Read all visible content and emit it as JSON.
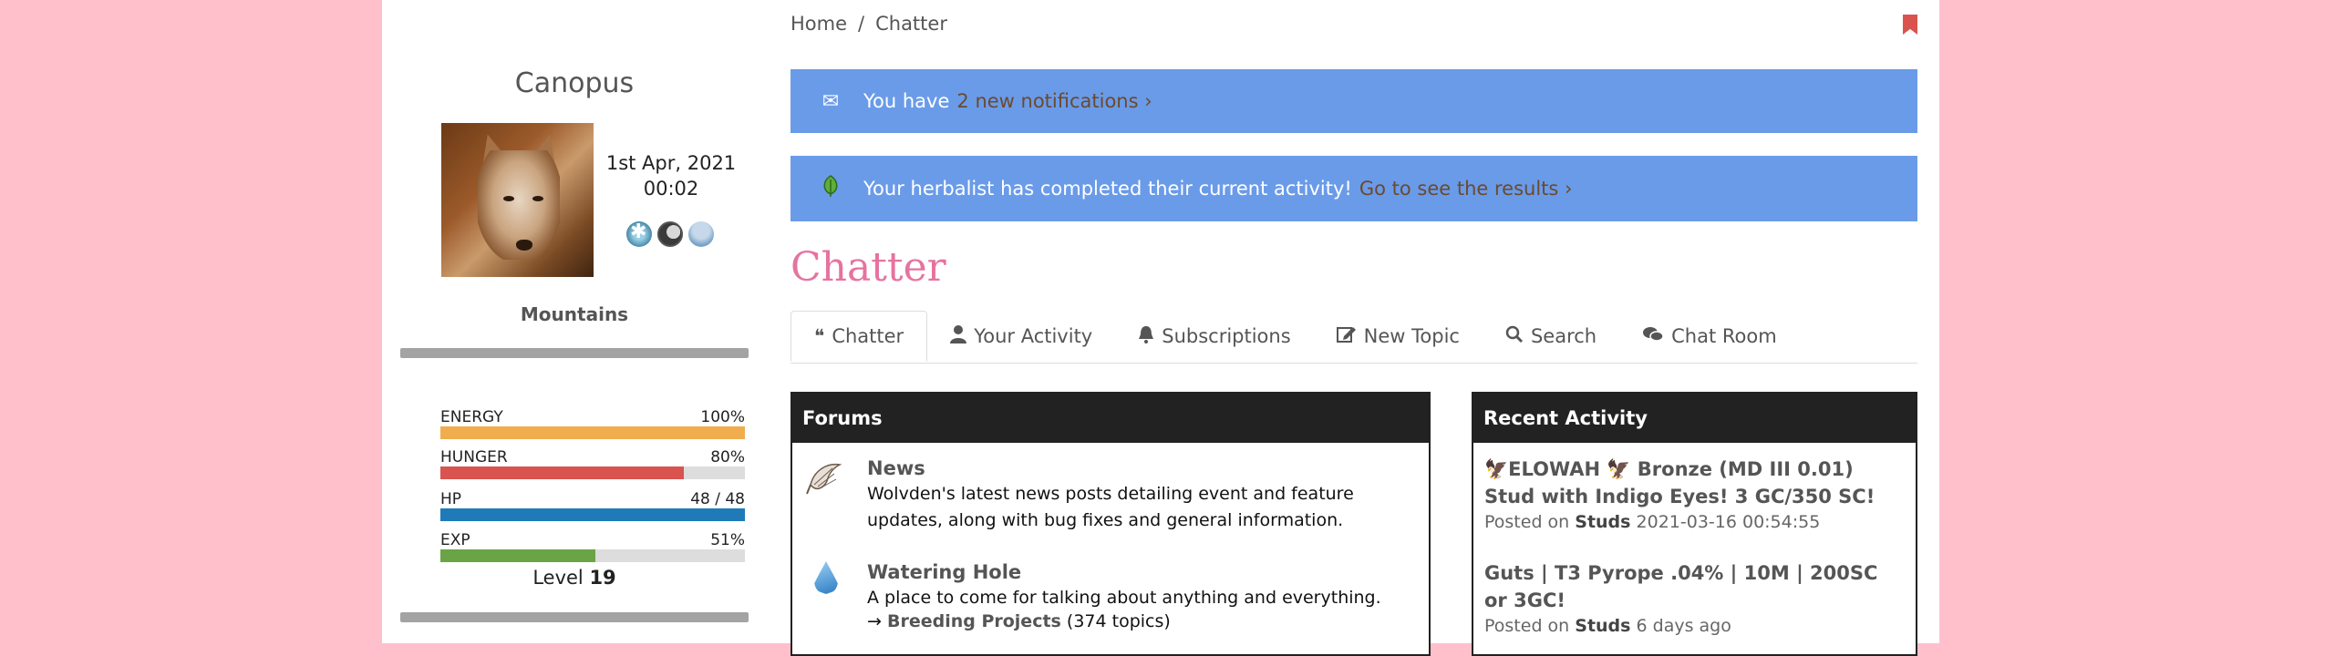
{
  "sidebar": {
    "character_name": "Canopus",
    "date": "1st Apr, 2021",
    "time": "00:02",
    "weather_icons": [
      "snowflake-icon",
      "moon-phase-icon",
      "storm-cloud-icon"
    ],
    "location": "Mountains",
    "stats": [
      {
        "label": "ENERGY",
        "value": "100%",
        "fraction": 1.0,
        "color": "#f0ad4e"
      },
      {
        "label": "HUNGER",
        "value": "80%",
        "fraction": 0.8,
        "color": "#d9534f"
      },
      {
        "label": "HP",
        "value": "48 / 48",
        "fraction": 1.0,
        "color": "#1f7ab8"
      },
      {
        "label": "EXP",
        "value": "51%",
        "fraction": 0.51,
        "color": "#6ba447"
      }
    ],
    "level_label": "Level",
    "level_value": "19"
  },
  "breadcrumb": {
    "home": "Home",
    "separator": "/",
    "current": "Chatter"
  },
  "alerts": {
    "notifications": {
      "icon": "envelope-icon",
      "text": "You have",
      "link": "2 new notifications ›"
    },
    "herbalist": {
      "icon": "leaf-icon",
      "text": "Your herbalist has completed their current activity!",
      "link": "Go to see the results ›"
    }
  },
  "page_title": "Chatter",
  "tabs": [
    {
      "label": "Chatter",
      "icon": "quote-icon",
      "active": true
    },
    {
      "label": "Your Activity",
      "icon": "user-icon",
      "active": false
    },
    {
      "label": "Subscriptions",
      "icon": "bell-icon",
      "active": false
    },
    {
      "label": "New Topic",
      "icon": "edit-icon",
      "active": false
    },
    {
      "label": "Search",
      "icon": "search-icon",
      "active": false
    },
    {
      "label": "Chat Room",
      "icon": "comments-icon",
      "active": false
    }
  ],
  "forums": {
    "heading": "Forums",
    "items": [
      {
        "title": "News",
        "description": "Wolvden's latest news posts detailing event and feature updates, along with bug fixes and general information.",
        "icon": "feather-bird-icon"
      },
      {
        "title": "Watering Hole",
        "description": "A place to come for talking about anything and everything.",
        "icon": "water-drop-icon",
        "subforum_arrow": "→",
        "subforum_link": "Breeding Projects",
        "subforum_count": "(374 topics)"
      }
    ]
  },
  "recent_activity": {
    "heading": "Recent Activity",
    "items": [
      {
        "title": "🦅ELOWAH 🦅 Bronze (MD III 0.01) Stud with Indigo Eyes! 3 GC/350 SC!",
        "posted_on_label": "Posted on",
        "board": "Studs",
        "time": "2021-03-16 00:54:55"
      },
      {
        "title": "Guts | T3 Pyrope .04% | 10M | 200SC or 3GC!",
        "posted_on_label": "Posted on",
        "board": "Studs",
        "time": "6 days ago"
      }
    ]
  }
}
